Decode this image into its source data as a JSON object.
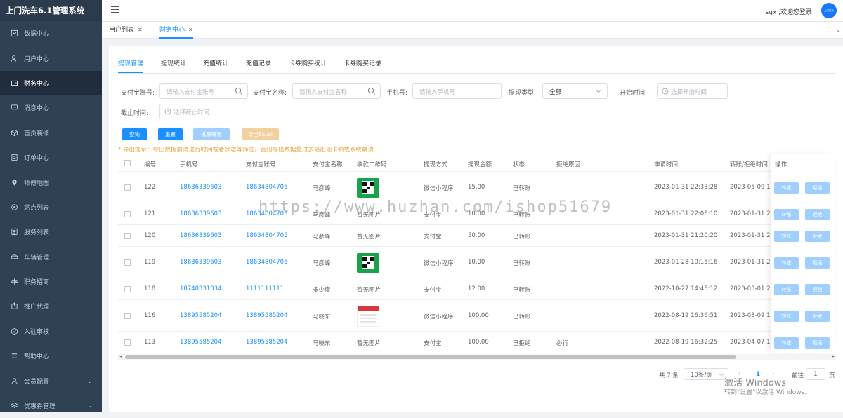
{
  "app": {
    "title": "上门洗车6.1管理系统"
  },
  "sidebar": {
    "items": [
      {
        "label": "数据中心",
        "icon": "chart-icon"
      },
      {
        "label": "用户中心",
        "icon": "user-icon"
      },
      {
        "label": "财务中心",
        "icon": "wallet-icon",
        "active": true
      },
      {
        "label": "消息中心",
        "icon": "message-icon"
      },
      {
        "label": "首页装修",
        "icon": "box-icon"
      },
      {
        "label": "订单中心",
        "icon": "order-icon"
      },
      {
        "label": "师傅地图",
        "icon": "location-icon"
      },
      {
        "label": "站点列表",
        "icon": "site-icon"
      },
      {
        "label": "服务列表",
        "icon": "list-icon"
      },
      {
        "label": "车辆管理",
        "icon": "car-icon"
      },
      {
        "label": "职务招商",
        "icon": "job-icon"
      },
      {
        "label": "推广代理",
        "icon": "share-icon"
      },
      {
        "label": "入驻审核",
        "icon": "audit-icon"
      },
      {
        "label": "帮助中心",
        "icon": "help-icon"
      },
      {
        "label": "会员配置",
        "icon": "member-icon",
        "arrow": true
      },
      {
        "label": "优惠券管理",
        "icon": "coupon-icon",
        "arrow": true
      }
    ]
  },
  "header": {
    "user_text": "sqx ,欢迎您登录",
    "avatar_text": "上门洗车"
  },
  "tabs": [
    {
      "label": "用户列表"
    },
    {
      "label": "财务中心",
      "active": true
    }
  ],
  "subtabs": [
    "提现管理",
    "提现统计",
    "充值统计",
    "充值记录",
    "卡券购买统计",
    "卡券购买记录"
  ],
  "filters": {
    "alipay_account_label": "支付宝账号:",
    "alipay_account_placeholder": "请输入支付宝账号",
    "alipay_name_label": "支付宝名称:",
    "alipay_name_placeholder": "请输入支付宝名称",
    "phone_label": "手机号:",
    "phone_placeholder": "请输入手机号",
    "type_label": "提现类型:",
    "type_value": "全部",
    "start_label": "开始时间:",
    "start_placeholder": "选择开始时间",
    "end_label": "截止时间:",
    "end_placeholder": "选择截止时间"
  },
  "buttons": {
    "query": "查询",
    "reset": "重置",
    "batch_transfer": "批量转账",
    "export": "导出Excel"
  },
  "colors": {
    "primary": "#1890ff",
    "sidebar_bg": "#304156",
    "warning": "#e6a23c",
    "disabled_blue": "#a0cfff",
    "disabled_orange": "#f3d19e"
  },
  "export_tip": "* 导出提示：导出数据前请进行时间或者状态等筛选，否则导出数据量过多易出现卡顿或系统崩溃",
  "table": {
    "headers": [
      "编号",
      "手机号",
      "支付宝账号",
      "支付宝名称",
      "收款二维码",
      "提现方式",
      "提现金额",
      "状态",
      "拒绝原因",
      "申请时间",
      "转账/拒绝时间",
      "操作"
    ],
    "rows": [
      {
        "id": "122",
        "phone": "18636339603",
        "account": "18634804705",
        "name": "马彦峰",
        "qr": "qr",
        "method": "微信小程序",
        "amount": "15.00",
        "status": "已转账",
        "reason": "",
        "apply": "2023-01-31 22:33:28",
        "done": "2023-05-09 10"
      },
      {
        "id": "121",
        "phone": "18636339603",
        "account": "18634804705",
        "name": "马彦峰",
        "qr_text": "暂无图片",
        "method": "支付宝",
        "amount": "10.00",
        "status": "已转账",
        "reason": "",
        "apply": "2023-01-31 22:05:10",
        "done": "2023-01-31 22"
      },
      {
        "id": "120",
        "phone": "18636339603",
        "account": "18634804705",
        "name": "马彦峰",
        "qr_text": "暂无图片",
        "method": "支付宝",
        "amount": "50.00",
        "status": "已转账",
        "reason": "",
        "apply": "2023-01-31 21:20:20",
        "done": "2023-01-31 21"
      },
      {
        "id": "119",
        "phone": "18636339603",
        "account": "18634804705",
        "name": "马彦峰",
        "qr": "qr",
        "method": "微信小程序",
        "amount": "10.00",
        "status": "已转账",
        "reason": "",
        "apply": "2023-01-28 10:15:16",
        "done": "2023-01-31 21"
      },
      {
        "id": "118",
        "phone": "18740331034",
        "account": "1111111111",
        "name": "多少度",
        "qr_text": "暂无图片",
        "method": "支付宝",
        "amount": "12.00",
        "status": "已转账",
        "reason": "",
        "apply": "2022-10-27 14:45:12",
        "done": "2023-03-01 23"
      },
      {
        "id": "116",
        "phone": "13895585204",
        "account": "13895585204",
        "name": "马晓东",
        "qr": "pic",
        "method": "微信小程序",
        "amount": "100.00",
        "status": "已转账",
        "reason": "",
        "apply": "2022-08-19 16:36:51",
        "done": "2023-03-09 19"
      },
      {
        "id": "113",
        "phone": "13895585204",
        "account": "13895585204",
        "name": "马晓东",
        "qr_text": "暂无图片",
        "method": "支付宝",
        "amount": "100.00",
        "status": "已拒绝",
        "reason": "必行",
        "apply": "2022-08-19 16:32:25",
        "done": "2023-04-07 13"
      }
    ],
    "op_transfer": "转账",
    "op_reject": "拒绝"
  },
  "pagination": {
    "total": "共 7 条",
    "page_size": "10条/页",
    "current": "1",
    "goto_label": "前往",
    "goto_value": "1",
    "page_unit": "页"
  },
  "watermark": "https://www.huzhan.com/ishop51679",
  "windows_activation": {
    "title": "激活 Windows",
    "subtitle": "转到\"设置\"以激活 Windows。"
  }
}
